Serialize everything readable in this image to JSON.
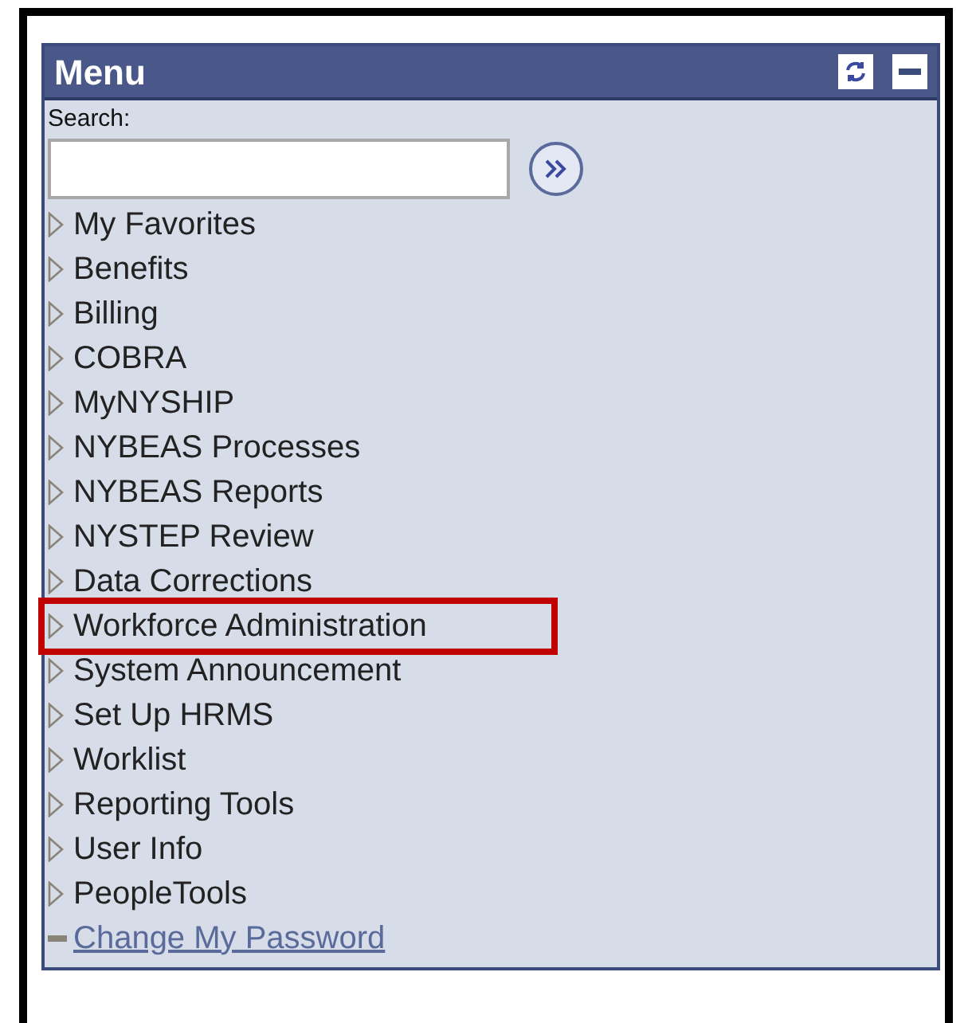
{
  "panel": {
    "title": "Menu"
  },
  "search": {
    "label": "Search:"
  },
  "items": [
    {
      "kind": "folder",
      "label": "My Favorites",
      "highlighted": false
    },
    {
      "kind": "folder",
      "label": "Benefits",
      "highlighted": false
    },
    {
      "kind": "folder",
      "label": "Billing",
      "highlighted": false
    },
    {
      "kind": "folder",
      "label": "COBRA",
      "highlighted": false
    },
    {
      "kind": "folder",
      "label": "MyNYSHIP",
      "highlighted": false
    },
    {
      "kind": "folder",
      "label": "NYBEAS Processes",
      "highlighted": false
    },
    {
      "kind": "folder",
      "label": "NYBEAS Reports",
      "highlighted": false
    },
    {
      "kind": "folder",
      "label": "NYSTEP Review",
      "highlighted": false
    },
    {
      "kind": "folder",
      "label": "Data Corrections",
      "highlighted": false
    },
    {
      "kind": "folder",
      "label": "Workforce Administration",
      "highlighted": true
    },
    {
      "kind": "folder",
      "label": "System Announcement",
      "highlighted": false
    },
    {
      "kind": "folder",
      "label": "Set Up HRMS",
      "highlighted": false
    },
    {
      "kind": "folder",
      "label": "Worklist",
      "highlighted": false
    },
    {
      "kind": "folder",
      "label": "Reporting Tools",
      "highlighted": false
    },
    {
      "kind": "folder",
      "label": "User Info",
      "highlighted": false
    },
    {
      "kind": "folder",
      "label": "PeopleTools",
      "highlighted": false
    },
    {
      "kind": "link",
      "label": "Change My Password",
      "highlighted": false
    }
  ]
}
